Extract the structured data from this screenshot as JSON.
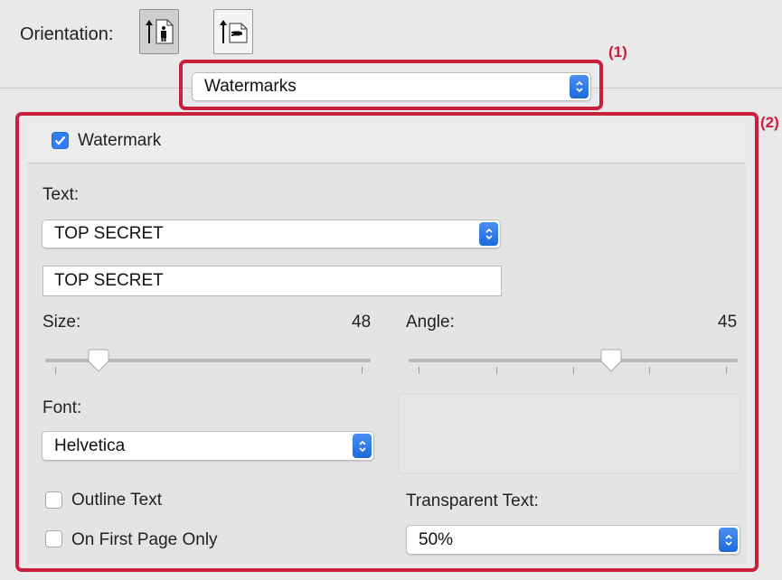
{
  "orientation": {
    "label": "Orientation:",
    "options": [
      "portrait-icon",
      "landscape-icon"
    ],
    "selected": "portrait"
  },
  "panel_select": {
    "value": "Watermarks"
  },
  "callouts": {
    "one": "(1)",
    "two": "(2)"
  },
  "watermark": {
    "enabled_label": "Watermark",
    "enabled": true,
    "text_label": "Text:",
    "text_select": "TOP SECRET",
    "text_value": "TOP SECRET",
    "size_label": "Size:",
    "size_value": "48",
    "size_level": 0.14,
    "angle_label": "Angle:",
    "angle_value": "45",
    "angle_level": 0.625,
    "font_label": "Font:",
    "font_value": "Helvetica",
    "outline_label": "Outline Text",
    "outline": false,
    "first_page_label": "On First Page Only",
    "first_page": false,
    "transparent_label": "Transparent Text:",
    "transparent_value": "50%"
  },
  "colors": {
    "accent": "#2f7ef6",
    "callout": "#c8203a"
  }
}
